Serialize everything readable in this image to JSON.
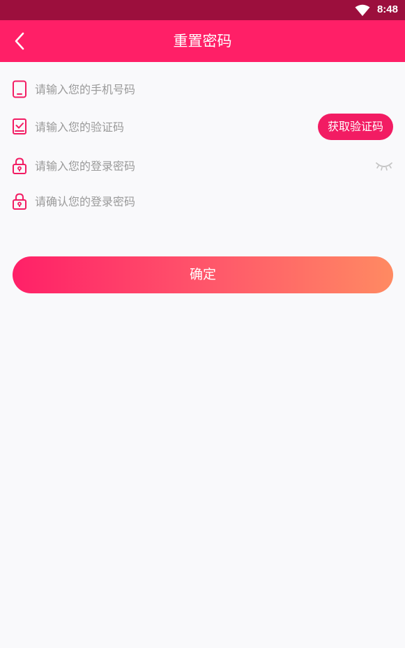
{
  "status_bar": {
    "time": "8:48",
    "wifi_icon": "wifi-icon"
  },
  "header": {
    "title": "重置密码",
    "back_icon": "chevron-left-icon"
  },
  "form": {
    "phone": {
      "placeholder": "请输入您的手机号码",
      "value": "",
      "icon": "phone-icon"
    },
    "code": {
      "placeholder": "请输入您的验证码",
      "value": "",
      "icon": "verify-code-icon",
      "button_label": "获取验证码"
    },
    "password": {
      "placeholder": "请输入您的登录密码",
      "value": "",
      "icon": "lock-icon",
      "toggle_icon": "eye-closed-icon"
    },
    "confirm_password": {
      "placeholder": "请确认您的登录密码",
      "value": "",
      "icon": "lock-icon"
    }
  },
  "submit": {
    "label": "确定"
  },
  "colors": {
    "status_bar": "#9c0f3d",
    "app_bar": "#ff1f67",
    "accent": "#f21c63",
    "gradient_start": "#ff2068",
    "gradient_end": "#ff8a62",
    "background": "#f9f9fb"
  }
}
